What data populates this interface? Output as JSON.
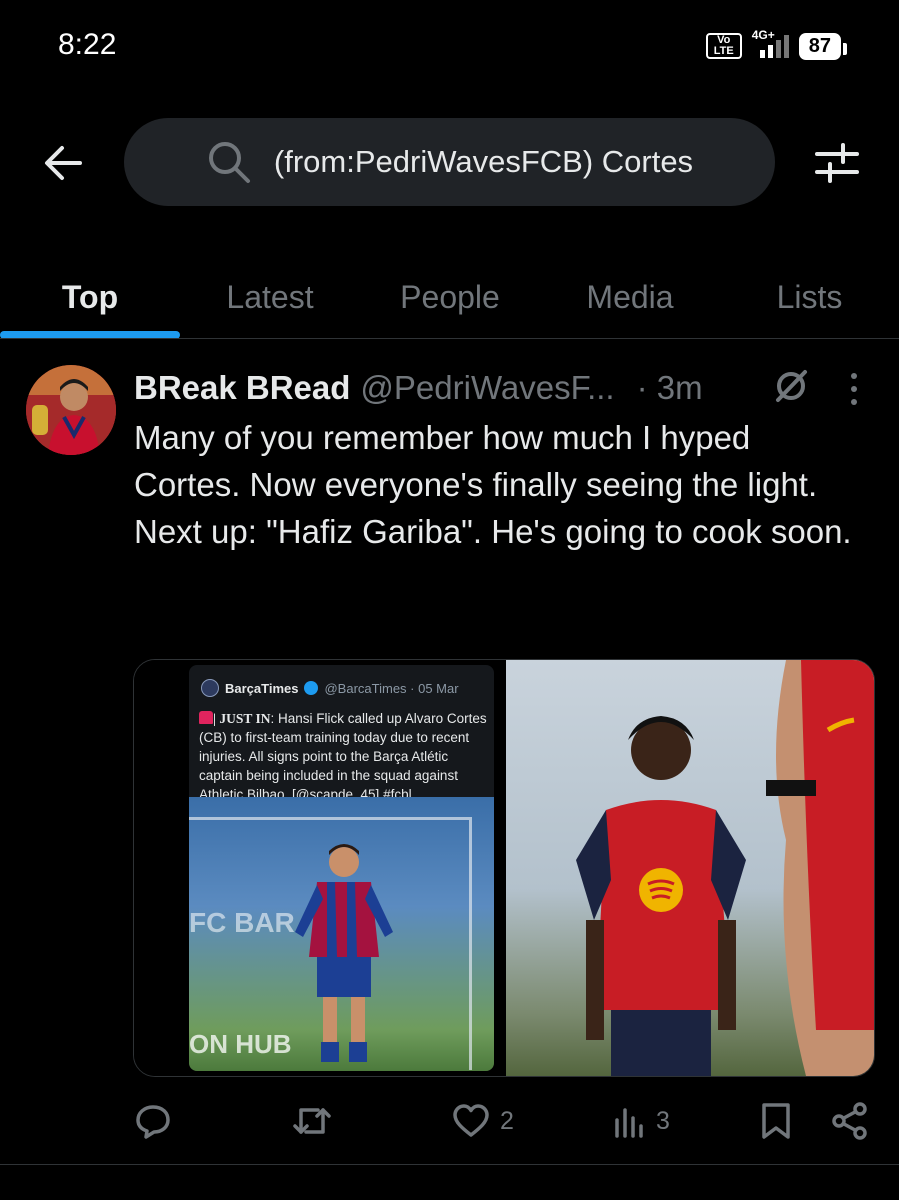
{
  "status_bar": {
    "time": "8:22",
    "volte_top": "Vo",
    "volte_bottom": "LTE",
    "network": "4G+",
    "battery": "87"
  },
  "search": {
    "query": "(from:PedriWavesFCB) Cortes"
  },
  "tabs": [
    {
      "label": "Top",
      "active": true
    },
    {
      "label": "Latest"
    },
    {
      "label": "People"
    },
    {
      "label": "Media"
    },
    {
      "label": "Lists"
    }
  ],
  "tweet": {
    "display_name": "BReak BRead",
    "handle": "@PedriWavesF...",
    "time": "· 3m",
    "text_lines": [
      "Many of you remember how much I hyped Cortes. Now everyone's finally seeing the light.",
      "Next up: \"Hafiz Gariba\". He's going to cook soon."
    ],
    "quote": {
      "name": "BarçaTimes",
      "handle": "@BarcaTimes · 05 Mar",
      "tag": "| JUST IN",
      "body": ": Hansi Flick called up Alvaro Cortes (CB) to first-team training today due to recent injuries. All signs point to the Barça Atlétic captain being included in the squad against Athletic Bilbao. [@scapde_45] #fcbl...",
      "photo_text_top": "FC BAR",
      "photo_text_bottom": "ON HUB"
    },
    "actions": {
      "replies": "",
      "retweets": "",
      "likes": "2",
      "views": "3"
    }
  },
  "colors": {
    "background": "#000000",
    "accent": "#1d9bf0",
    "muted": "#71767b",
    "text": "#e7e9ea"
  },
  "icons": [
    "back-arrow-icon",
    "search-icon",
    "filter-sliders-icon",
    "grok-icon",
    "more-vertical-icon",
    "reply-icon",
    "retweet-icon",
    "like-heart-icon",
    "views-chart-icon",
    "bookmark-icon",
    "share-icon"
  ]
}
